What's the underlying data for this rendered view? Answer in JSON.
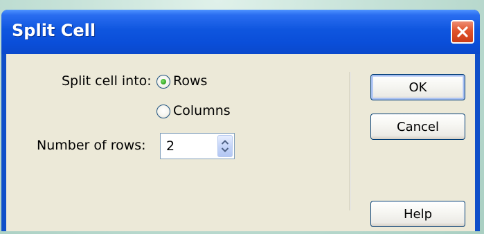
{
  "dialog": {
    "title": "Split Cell",
    "close_icon": "close-icon"
  },
  "split": {
    "label": "Split cell into:",
    "options": [
      {
        "label": "Rows",
        "selected": true
      },
      {
        "label": "Columns",
        "selected": false
      }
    ]
  },
  "rows_field": {
    "label": "Number of rows:",
    "value": "2"
  },
  "buttons": {
    "ok": "OK",
    "cancel": "Cancel",
    "help": "Help"
  },
  "colors": {
    "titlebar": "#0a4ed9",
    "client": "#ece9d8",
    "close": "#e0532c",
    "radio_selected": "#36a925"
  }
}
